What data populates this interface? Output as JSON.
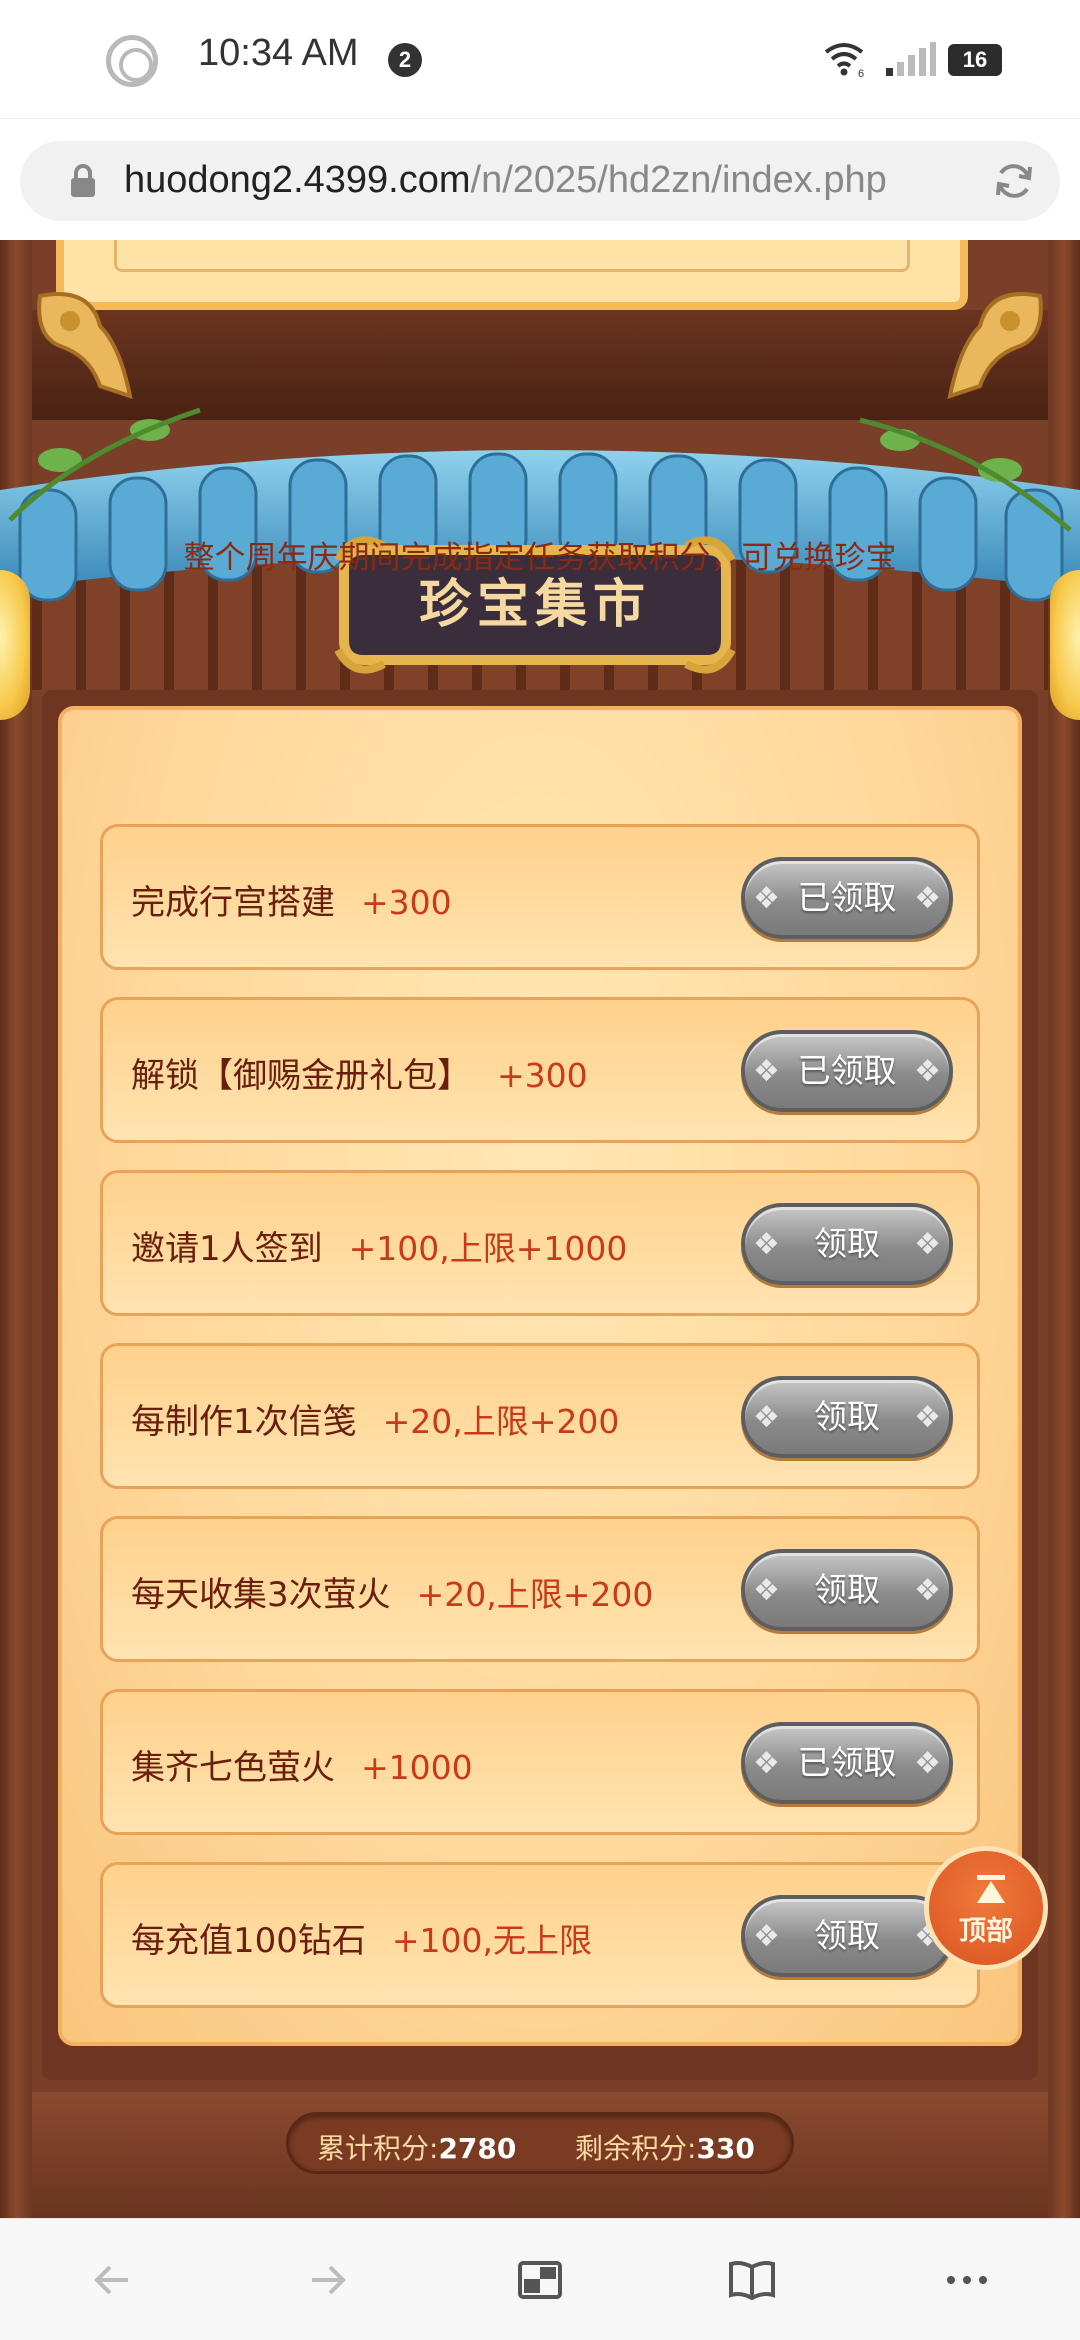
{
  "status_bar": {
    "time": "10:34 AM",
    "notification_count": "2",
    "wifi_sub": "6",
    "battery": "16"
  },
  "url_bar": {
    "domain": "huodong2.4399.com",
    "path": "/n/2025/hd2zn/index.php"
  },
  "page": {
    "title": "珍宝集市",
    "intro": "整个周年庆期间完成指定任务获取积分，可兑换珍宝",
    "tasks": [
      {
        "label": "完成行宫搭建",
        "points": "+300",
        "button": "已领取"
      },
      {
        "label": "解锁【御赐金册礼包】",
        "points": "+300",
        "button": "已领取"
      },
      {
        "label": "邀请1人签到",
        "points": "+100,上限+1000",
        "button": "领取"
      },
      {
        "label": "每制作1次信笺",
        "points": "+20,上限+200",
        "button": "领取"
      },
      {
        "label": "每天收集3次萤火",
        "points": "+20,上限+200",
        "button": "领取"
      },
      {
        "label": "集齐七色萤火",
        "points": "+1000",
        "button": "已领取"
      },
      {
        "label": "每充值100钻石",
        "points": "+100,无上限",
        "button": "领取"
      }
    ],
    "top_button": "顶部",
    "score": {
      "total_label": "累计积分:",
      "total_value": "2780",
      "remain_label": "剩余积分:",
      "remain_value": "330"
    }
  },
  "colors": {
    "task_text": "#6a1e0e",
    "points_text": "#c83a18",
    "panel_bg": "#ffd79a",
    "roof_tile": "#4ea5d0"
  },
  "bottom_nav": {
    "icons": [
      "back-icon",
      "forward-icon",
      "tabs-icon",
      "bookmarks-icon",
      "more-icon"
    ]
  }
}
